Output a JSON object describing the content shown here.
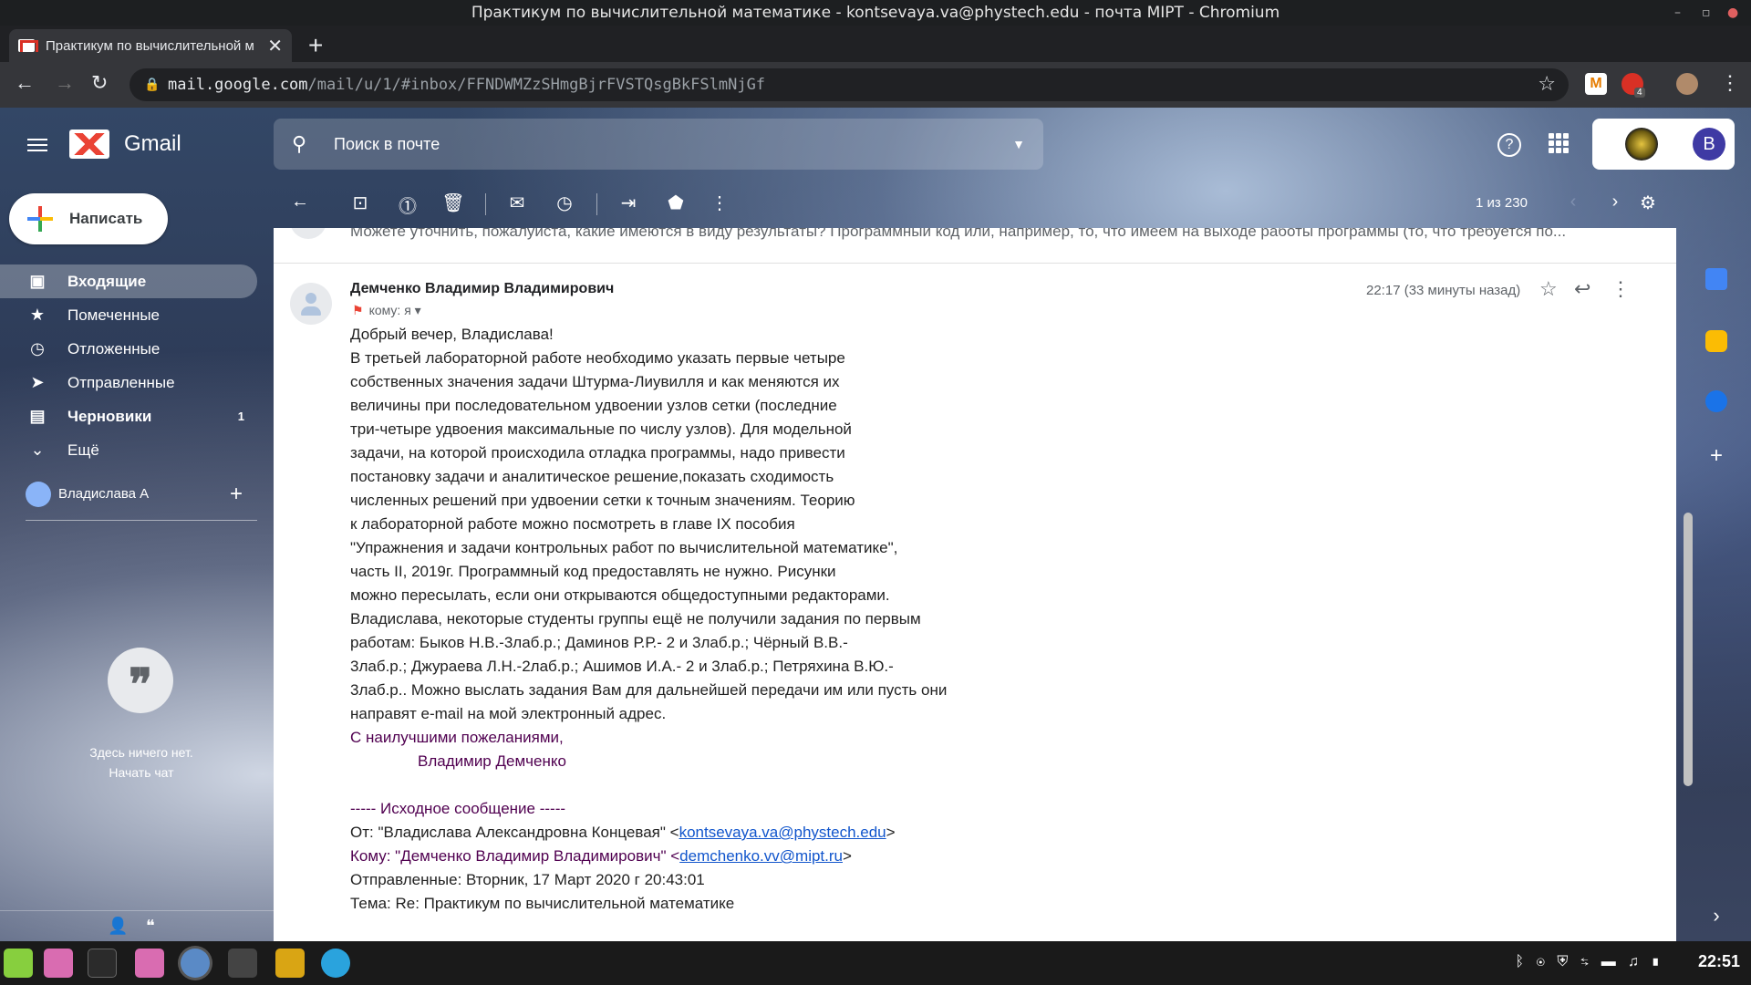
{
  "window": {
    "title": "Практикум по вычислительной математике - kontsevaya.va@phystech.edu - почта MIPT - Chromium"
  },
  "browser": {
    "tab_title": "Практикум по вычислительной м",
    "url_host": "mail.google.com",
    "url_path": "/mail/u/1/#inbox/FFNDWMZzSHmgBjrFVSTQsgBkFSlmNjGf",
    "extension_badge": "4"
  },
  "gmail": {
    "app_name": "Gmail",
    "search_placeholder": "Поиск в почте",
    "account_initial": "В",
    "compose_label": "Написать",
    "nav": [
      {
        "label": "Входящие",
        "icon": "inbox-icon",
        "count": ""
      },
      {
        "label": "Помеченные",
        "icon": "star-icon",
        "count": ""
      },
      {
        "label": "Отложенные",
        "icon": "clock-icon",
        "count": ""
      },
      {
        "label": "Отправленные",
        "icon": "send-icon",
        "count": ""
      },
      {
        "label": "Черновики",
        "icon": "draft-icon",
        "count": "1"
      },
      {
        "label": "Ещё",
        "icon": "chevron-down-icon",
        "count": ""
      }
    ],
    "hangouts_user": "Владислава А",
    "chat_empty_line1": "Здесь ничего нет.",
    "chat_empty_line2": "Начать чат",
    "pagination": "1 из 230"
  },
  "thread": {
    "previous_snippet": "Можете уточнить, пожалуйста, какие имеются в виду результаты? Программный код или, например, то, что имеем на выходе работы программы (то, что требуется по...",
    "sender": "Демченко Владимир Владимирович",
    "to_label": "кому: я",
    "time": "22:17 (33 минуты назад)",
    "body_lines": [
      "Добрый вечер, Владислава!",
      "В третьей лабораторной работе необходимо указать первые четыре",
      "собственных значения задачи Штурма-Лиувилля и как меняются их",
      "величины при последовательном удвоении узлов сетки (последние",
      "три-четыре удвоения максимальные по числу узлов). Для модельной",
      "задачи, на которой происходила отладка программы, надо привести",
      "постановку задачи и аналитическое решение,показать сходимость",
      "численных решений при удвоении сетки к точным значениям. Теорию",
      "к лабораторной работе можно посмотреть в главе IX пособия",
      "\"Упражнения и задачи контрольных работ по вычислительной математике\",",
      "часть II, 2019г. Программный код предоставлять не нужно. Рисунки",
      "можно пересылать, если они открываются общедоступными редакторами.",
      "Владислава, некоторые студенты группы ещё не получили задания по первым",
      "работам: Быков Н.В.-3лаб.р.; Даминов Р.Р.- 2 и 3лаб.р.; Чёрный В.В.-",
      "3лаб.р.;  Джураева Л.Н.-2лаб.р.; Ашимов И.А.- 2 и 3лаб.р.; Петряхина В.Ю.-",
      "3лаб.р.. Можно выслать задания Вам для дальнейшей передачи им или пусть они",
      "направят e-mail на мой электронный адрес."
    ],
    "sign_1": "С наилучшими пожеланиями,",
    "sign_2": "Владимир Демченко",
    "orig_header": "----- Исходное сообщение -----",
    "from_prefix": "От: \"Владислава Александровна Концевая\" <",
    "from_email": "kontsevaya.va@phystech.edu",
    "from_suffix": ">",
    "to_prefix": "Кому: \"Демченко Владимир Владимирович\" <",
    "to_email": "demchenko.vv@mipt.ru",
    "to_suffix": ">",
    "sent_line": "Отправленные: Вторник, 17 Март 2020 г 20:43:01",
    "subject_line": "Тема: Re: Практикум по вычислительной математике"
  },
  "taskbar": {
    "clock": "22:51"
  },
  "colors": {
    "accent_red": "#ea4335",
    "link": "#1155cc",
    "signature_purple": "#500050"
  }
}
